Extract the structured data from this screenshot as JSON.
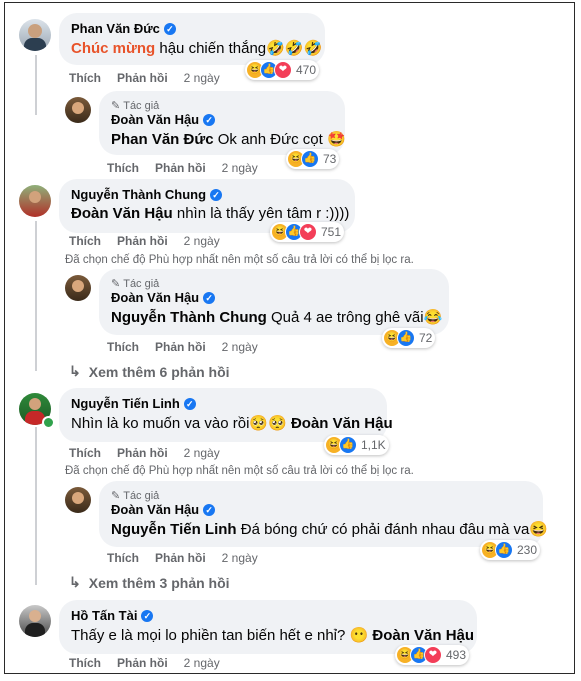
{
  "comments": [
    {
      "name": "Phan Văn Đức",
      "highlight": "Chúc mừng",
      "text": " hậu chiến thắng🤣🤣🤣",
      "like": "Thích",
      "reply": "Phản hồi",
      "time": "2 ngày",
      "reactions": [
        "haha",
        "like",
        "love"
      ],
      "count": "470"
    },
    {
      "author_tag": "Tác giả",
      "name": "Đoàn Văn Hậu",
      "mention": "Phan Văn Đức",
      "text": " Ok anh Đức cọt 🤩",
      "like": "Thích",
      "reply": "Phản hồi",
      "time": "2 ngày",
      "reactions": [
        "haha",
        "like"
      ],
      "count": "73"
    },
    {
      "name": "Nguyễn Thành Chung",
      "mention": "Đoàn Văn Hậu",
      "text": " nhìn là thấy yên tâm r :))))",
      "like": "Thích",
      "reply": "Phản hồi",
      "time": "2 ngày",
      "reactions": [
        "haha",
        "like",
        "love"
      ],
      "count": "751"
    },
    {
      "author_tag": "Tác giả",
      "name": "Đoàn Văn Hậu",
      "mention": "Nguyễn Thành Chung",
      "text": " Quả 4 ae trông ghê vãi😂",
      "like": "Thích",
      "reply": "Phản hồi",
      "time": "2 ngày",
      "reactions": [
        "haha",
        "like"
      ],
      "count": "72"
    },
    {
      "name": "Nguyễn Tiến Linh",
      "text": "Nhìn là ko muốn va vào rồi🥺🥺 ",
      "mention_after": "Đoàn Văn Hậu",
      "like": "Thích",
      "reply": "Phản hồi",
      "time": "2 ngày",
      "reactions": [
        "haha",
        "like"
      ],
      "count": "1,1K"
    },
    {
      "author_tag": "Tác giả",
      "name": "Đoàn Văn Hậu",
      "mention": "Nguyễn Tiến Linh",
      "text": " Đá bóng chứ có phải đánh nhau đâu mà va😆",
      "like": "Thích",
      "reply": "Phản hồi",
      "time": "2 ngày",
      "reactions": [
        "haha",
        "like"
      ],
      "count": "230"
    },
    {
      "name": "Hồ Tấn Tài",
      "text": "Thấy e là mọi lo phiền tan biến hết e nhỉ? 😶 ",
      "mention_after": "Đoàn Văn Hậu",
      "like": "Thích",
      "reply": "Phản hồi",
      "time": "2 ngày",
      "reactions": [
        "haha",
        "like",
        "love"
      ],
      "count": "493"
    }
  ],
  "filter_note": "Đã chọn chế độ Phù hợp nhất nên một số câu trả lời có thể bị lọc ra.",
  "more_replies_1": "Xem thêm 6 phản hồi",
  "more_replies_2": "Xem thêm 3 phản hồi",
  "icons": {
    "haha": "😆",
    "like": "👍",
    "love": "❤"
  }
}
